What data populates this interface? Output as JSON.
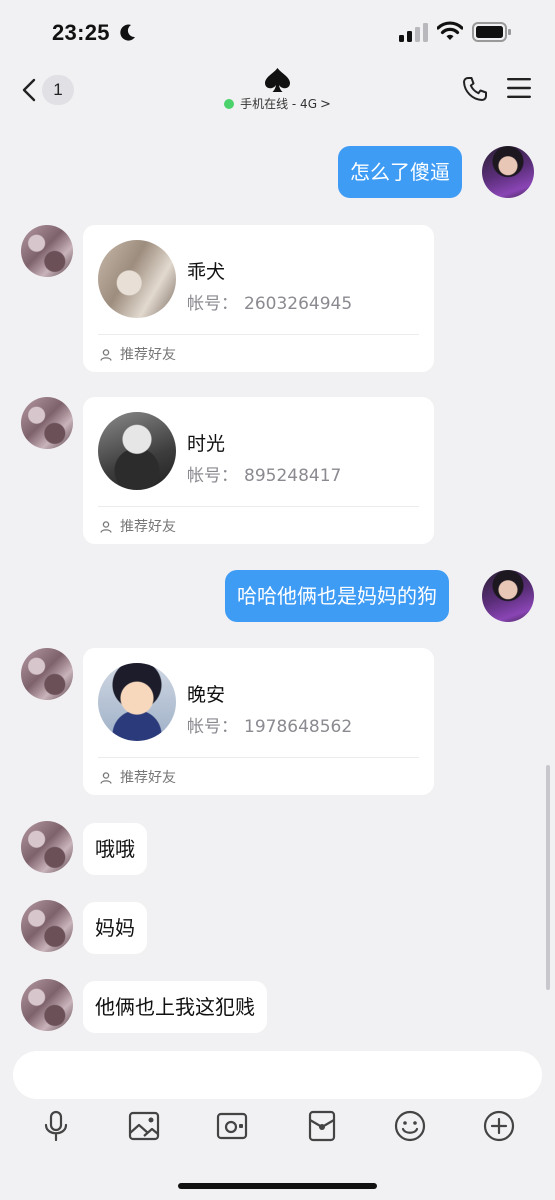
{
  "status_bar": {
    "time": "23:25",
    "icons": [
      "moon-icon",
      "cellular-signal-icon",
      "wifi-icon",
      "battery-icon"
    ]
  },
  "nav": {
    "unread_count": "1",
    "contact_icon": "spade-icon",
    "online_status": "手机在线 - 4G",
    "status_chevron": ">",
    "online_color": "#4cd26b"
  },
  "messages": [
    {
      "type": "text",
      "side": "me",
      "text": "怎么了傻逼"
    },
    {
      "type": "card",
      "side": "other",
      "name": "乖犬",
      "account_label": "帐号：",
      "account": "2603264945",
      "footer": "推荐好友"
    },
    {
      "type": "card",
      "side": "other",
      "name": "时光",
      "account_label": "帐号：",
      "account": "895248417",
      "footer": "推荐好友"
    },
    {
      "type": "text",
      "side": "me",
      "text": "哈哈他俩也是妈妈的狗"
    },
    {
      "type": "card",
      "side": "other",
      "name": "晚安",
      "account_label": "帐号：",
      "account": "1978648562",
      "footer": "推荐好友"
    },
    {
      "type": "text",
      "side": "other",
      "text": "哦哦"
    },
    {
      "type": "text",
      "side": "other",
      "text": "妈妈"
    },
    {
      "type": "text",
      "side": "other",
      "text": "他俩也上我这犯贱"
    }
  ],
  "input": {
    "placeholder": ""
  },
  "toolbar": [
    "microphone-icon",
    "image-icon",
    "camera-icon",
    "red-packet-icon",
    "emoji-icon",
    "plus-icon"
  ],
  "colors": {
    "background": "#f1f1f3",
    "my_bubble": "#3f9cf5",
    "other_bubble": "#ffffff"
  }
}
